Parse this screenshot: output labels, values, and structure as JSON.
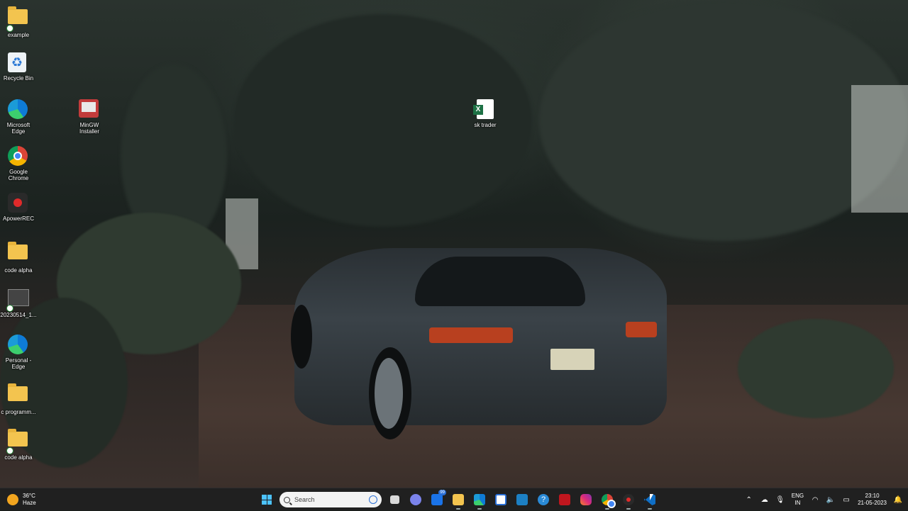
{
  "desktop": {
    "icons": [
      {
        "label": "example"
      },
      {
        "label": "Recycle Bin"
      },
      {
        "label": "Microsoft Edge"
      },
      {
        "label": "MinGW Installer"
      },
      {
        "label": "Google Chrome"
      },
      {
        "label": "ApowerREC"
      },
      {
        "label": "code alpha"
      },
      {
        "label": "20230514_1..."
      },
      {
        "label": "Personal - Edge"
      },
      {
        "label": "c programm..."
      },
      {
        "label": "code alpha"
      },
      {
        "label": "sk trader"
      }
    ]
  },
  "taskbar": {
    "weather": {
      "temp": "36°C",
      "condition": "Haze"
    },
    "search": {
      "placeholder": "Search"
    },
    "mail_badge": "99",
    "pinned": [
      "start-icon",
      "search",
      "task-view-icon",
      "teams-icon",
      "mail-icon",
      "file-explorer-icon",
      "edge-icon",
      "store-icon",
      "stock-app-icon",
      "help-icon",
      "mcafee-icon",
      "instagram-icon",
      "chrome-icon",
      "recorder-icon",
      "vscode-icon"
    ],
    "tray": {
      "language": "ENG",
      "region": "IN",
      "time": "23:10",
      "date": "21-05-2023"
    }
  },
  "colors": {
    "taskbar_bg": "#202020",
    "accent": "#4cc2ff",
    "folder": "#f3c44f"
  }
}
